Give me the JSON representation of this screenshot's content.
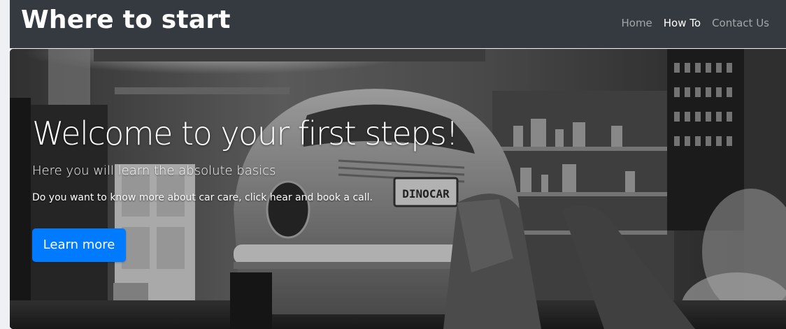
{
  "navbar": {
    "brand": "Where to start",
    "links": [
      {
        "label": "Home",
        "active": false
      },
      {
        "label": "How To",
        "active": true
      },
      {
        "label": "Contact Us",
        "active": false
      }
    ],
    "background_color": "#343a40"
  },
  "hero": {
    "title": "Welcome to your first steps!",
    "subtitle": "Here you will learn the absolute basics",
    "text": "Do you want to know more about car care, click hear and book a call.",
    "button_label": "Learn more",
    "button_color": "#007bff",
    "license_plate": "DINOCAR"
  }
}
